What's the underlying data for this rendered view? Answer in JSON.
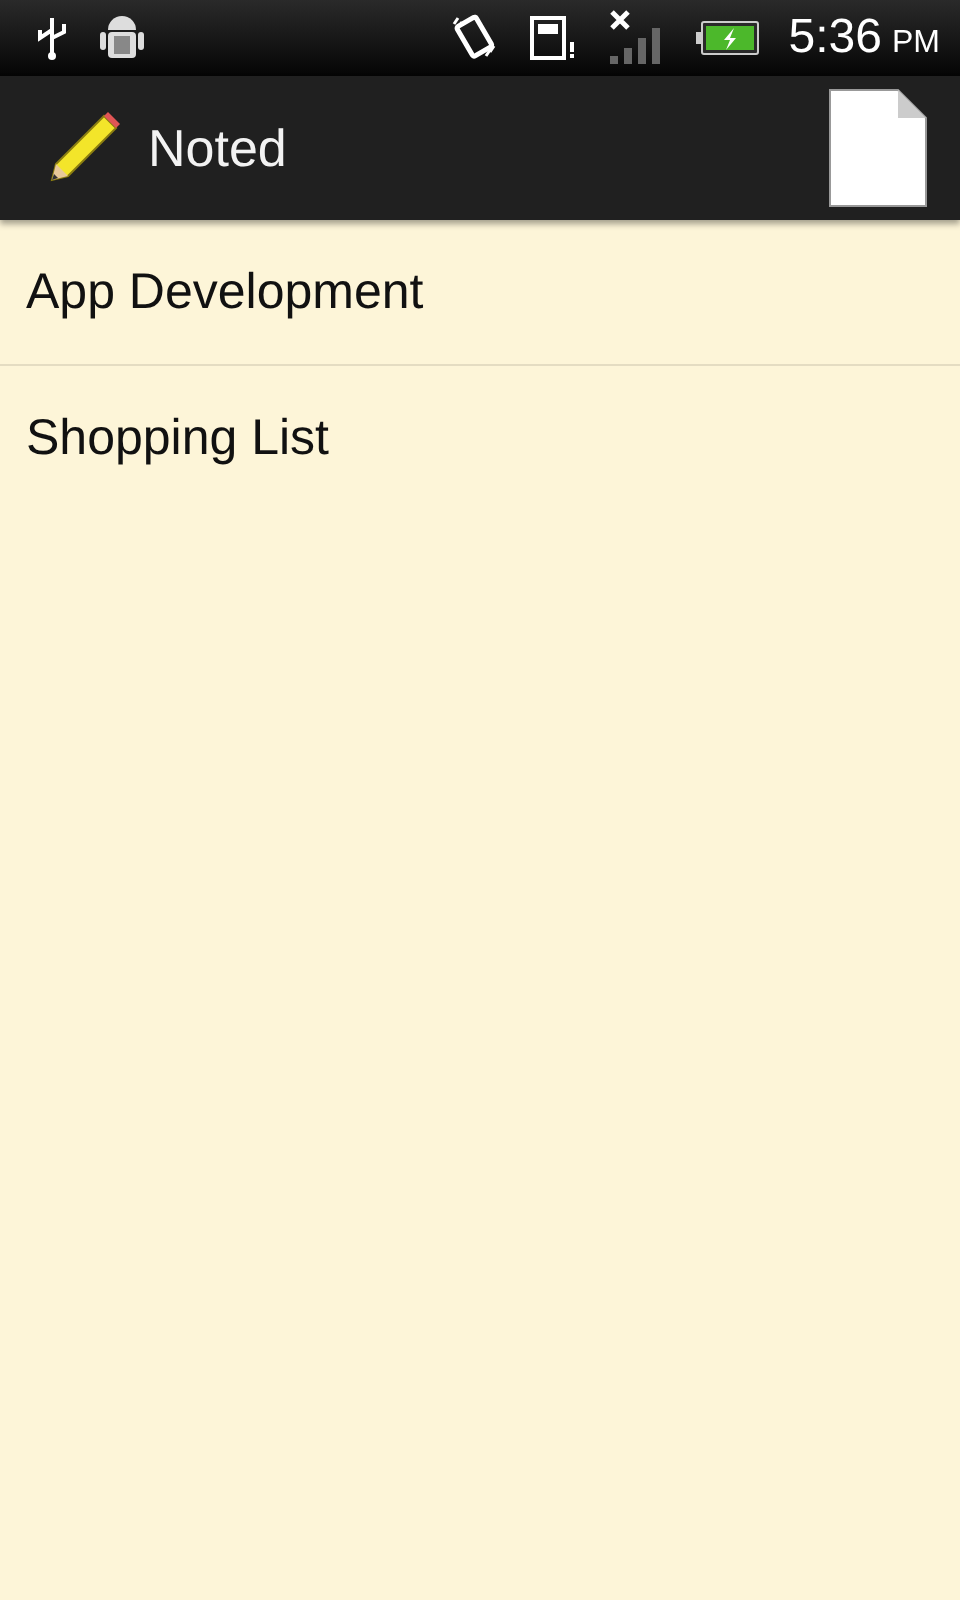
{
  "status_bar": {
    "time": "5:36",
    "meridiem": "PM"
  },
  "action_bar": {
    "title": "Noted"
  },
  "notes": [
    {
      "title": "App Development"
    },
    {
      "title": "Shopping List"
    }
  ]
}
